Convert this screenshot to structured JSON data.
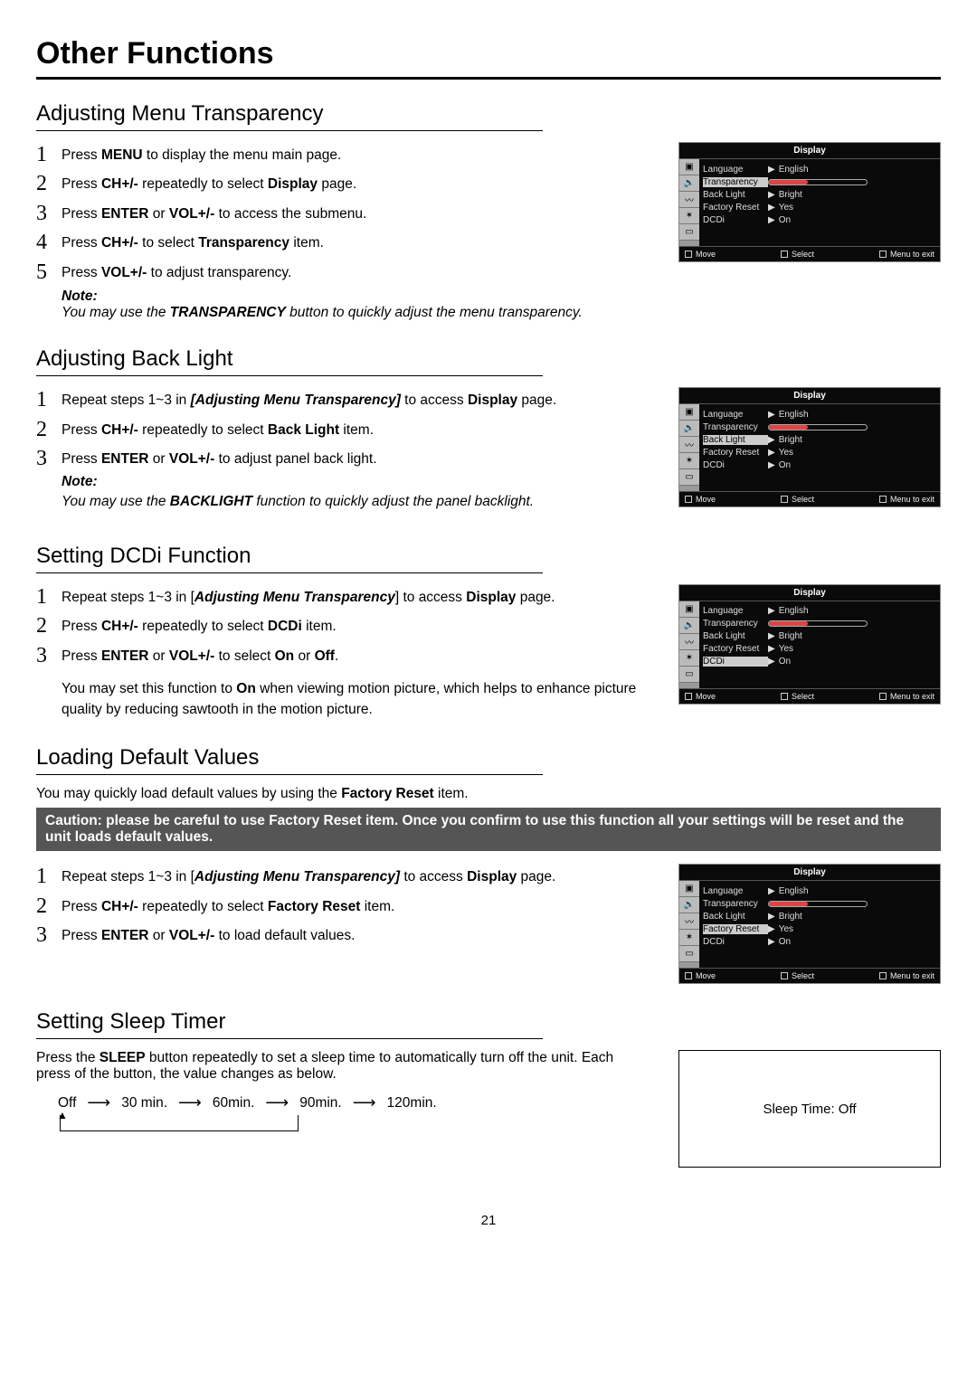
{
  "page_title": "Other Functions",
  "page_number": "21",
  "sections": {
    "transparency": {
      "title": "Adjusting Menu Transparency",
      "steps": [
        {
          "n": "1",
          "pre": "Press ",
          "b1": "MENU",
          "post": " to display the menu main page."
        },
        {
          "n": "2",
          "pre": "Press ",
          "b1": "CH+/-",
          "mid": " repeatedly to select ",
          "b2": "Display",
          "post": " page."
        },
        {
          "n": "3",
          "pre": "Press ",
          "b1": "ENTER",
          "mid": " or ",
          "b2": "VOL+/-",
          "post": " to access the submenu."
        },
        {
          "n": "4",
          "pre": "Press ",
          "b1": "CH+/-",
          "mid": " to select ",
          "b2": "Transparency",
          "post": " item."
        },
        {
          "n": "5",
          "pre": "Press ",
          "b1": "VOL+/-",
          "post": " to adjust transparency."
        }
      ],
      "note_title": "Note:",
      "note_pre": "You may use the ",
      "note_b": "TRANSPARENCY",
      "note_post": " button to quickly adjust the menu transparency."
    },
    "backlight": {
      "title": "Adjusting Back Light",
      "steps": [
        {
          "n": "1",
          "pre": "Repeat steps 1~3 in ",
          "bi": "[Adjusting Menu Transparency]",
          "mid": " to access ",
          "b2": "Display",
          "post": " page."
        },
        {
          "n": "2",
          "pre": "Press ",
          "b1": "CH+/-",
          "mid": " repeatedly to select ",
          "b2": "Back Light",
          "post": " item."
        },
        {
          "n": "3",
          "pre": "Press ",
          "b1": "ENTER",
          "mid": " or ",
          "b2": "VOL+/-",
          "post": " to adjust panel back light."
        }
      ],
      "note_title": "Note:",
      "note_pre": "You may use the ",
      "note_b": "BACKLIGHT",
      "note_post": " function to quickly adjust the panel backlight."
    },
    "dcdi": {
      "title": "Setting DCDi Function",
      "steps": [
        {
          "n": "1",
          "pre": "Repeat steps 1~3 in [",
          "bi": "Adjusting Menu Transparency",
          "mid": "] to access ",
          "b2": "Display",
          "post": " page."
        },
        {
          "n": "2",
          "pre": "Press ",
          "b1": "CH+/-",
          "mid": " repeatedly to select ",
          "b2": "DCDi",
          "post": " item."
        },
        {
          "n": "3",
          "pre": "Press ",
          "b1": "ENTER",
          "mid": " or ",
          "b2": "VOL+/-",
          "mid2": " to select ",
          "b3": "On",
          "mid3": " or ",
          "b4": "Off",
          "post": "."
        }
      ],
      "extra_pre": "You may set this function to ",
      "extra_b": "On",
      "extra_post": " when viewing motion picture, which helps to enhance picture quality by reducing sawtooth in the motion picture."
    },
    "default": {
      "title": "Loading Default Values",
      "intro_pre": "You may quickly load default values by using the ",
      "intro_b": "Factory Reset",
      "intro_post": " item.",
      "caution": "Caution: please be careful to use Factory Reset item. Once you confirm to use this function all your settings will be reset and the unit loads default values.",
      "steps": [
        {
          "n": "1",
          "pre": "Repeat steps 1~3 in [",
          "bi": "Adjusting Menu Transparency]",
          "mid": " to access ",
          "b2": "Display",
          "post": " page."
        },
        {
          "n": "2",
          "pre": "Press ",
          "b1": "CH+/-",
          "mid": " repeatedly to select ",
          "b2": "Factory Reset",
          "post": " item."
        },
        {
          "n": "3",
          "pre": "Press ",
          "b1": "ENTER",
          "mid": " or ",
          "b2": "VOL+/-",
          "post": " to load default values."
        }
      ]
    },
    "sleep": {
      "title": "Setting Sleep Timer",
      "text_pre": "Press the ",
      "text_b": "SLEEP",
      "text_post": " button repeatedly to set a sleep time to automatically turn off the unit. Each press of the button, the value changes as below.",
      "flow": [
        "Off",
        "30 min.",
        "60min.",
        "90min.",
        "120min."
      ],
      "box_text": "Sleep Time: Off"
    }
  },
  "osd": {
    "title": "Display",
    "foot_move": "Move",
    "foot_select": "Select",
    "foot_exit": "Menu to exit",
    "params": {
      "lang_label": "Language",
      "lang_val": "English",
      "trans_label": "Transparency",
      "bl_label": "Back Light",
      "bl_val": "Bright",
      "fr_label": "Factory Reset",
      "fr_val": "Yes",
      "dcdi_label": "DCDi",
      "dcdi_val": "On"
    }
  }
}
